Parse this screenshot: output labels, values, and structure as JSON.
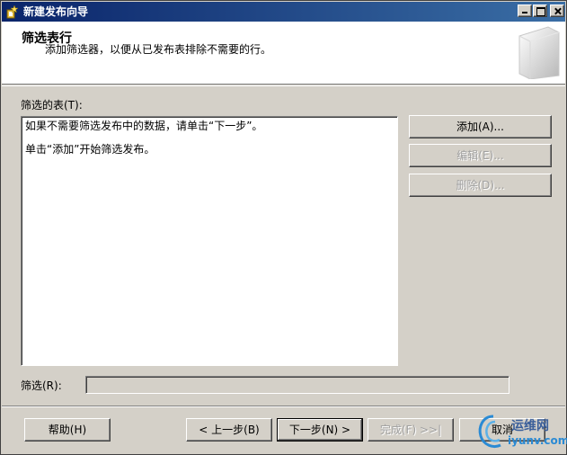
{
  "window": {
    "title": "新建发布向导"
  },
  "header": {
    "title": "筛选表行",
    "subtitle": "添加筛选器，以便从已发布表排除不需要的行。"
  },
  "filtered_tables": {
    "label": "筛选的表(T):",
    "lines": [
      "如果不需要筛选发布中的数据，请单击“下一步”。",
      "单击“添加”开始筛选发布。"
    ]
  },
  "side_buttons": {
    "add": "添加(A)...",
    "edit": "编辑(E)...",
    "delete": "删除(D)..."
  },
  "filter": {
    "label": "筛选(R):",
    "value": ""
  },
  "footer": {
    "help": "帮助(H)",
    "back": "< 上一步(B)",
    "next": "下一步(N) >",
    "finish": "完成(F) >>|",
    "cancel": "取消"
  },
  "watermark": {
    "cn": "运维网",
    "url": "iyunv.com"
  },
  "colors": {
    "titlebar": "#0a246a",
    "face": "#d4d0c8",
    "disabled_text": "#a0a0a0",
    "watermark_blue": "#2a8ad4"
  }
}
